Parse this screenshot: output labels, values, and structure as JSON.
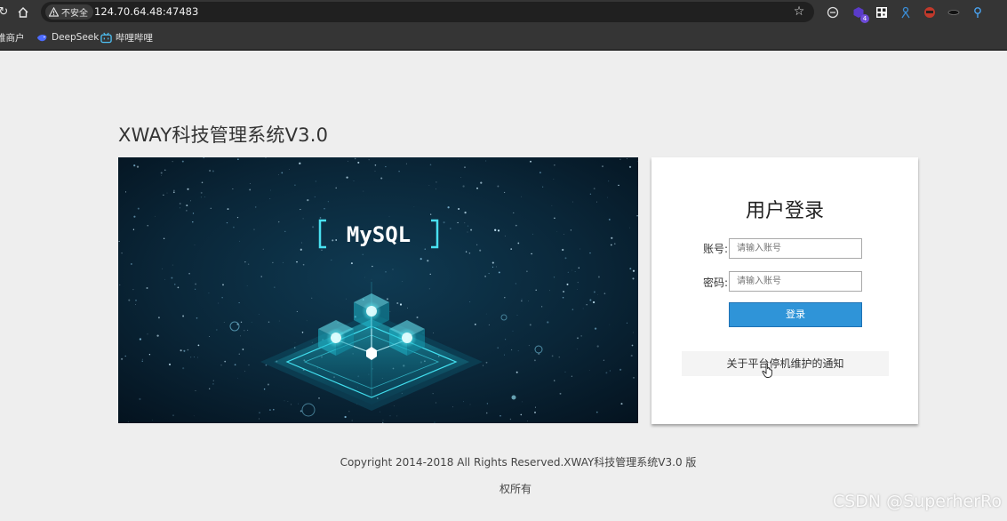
{
  "browser": {
    "security_label": "不安全",
    "url": "124.70.64.48:47483",
    "extension_badge": "4",
    "bookmarks": [
      {
        "label": "唯商户"
      },
      {
        "label": "DeepSeek"
      },
      {
        "label": "哔哩哔哩"
      }
    ]
  },
  "page": {
    "title": "XWAY科技管理系统V3.0"
  },
  "banner": {
    "logo_text": "MySQL"
  },
  "login": {
    "heading": "用户登录",
    "account_label": "账号:",
    "account_placeholder": "请输入账号",
    "password_label": "密码:",
    "password_placeholder": "请输入账号",
    "submit_label": "登录",
    "notice_link": "关于平台停机维护的通知"
  },
  "footer": {
    "line1": "Copyright 2014-2018 All Rights Reserved.XWAY科技管理系统V3.0 版",
    "line2": "权所有"
  },
  "watermark": "CSDN @SuperherRo",
  "colors": {
    "page_bg": "#eeeeee",
    "button_blue": "#2f94d8",
    "chrome_dark": "#353535"
  }
}
